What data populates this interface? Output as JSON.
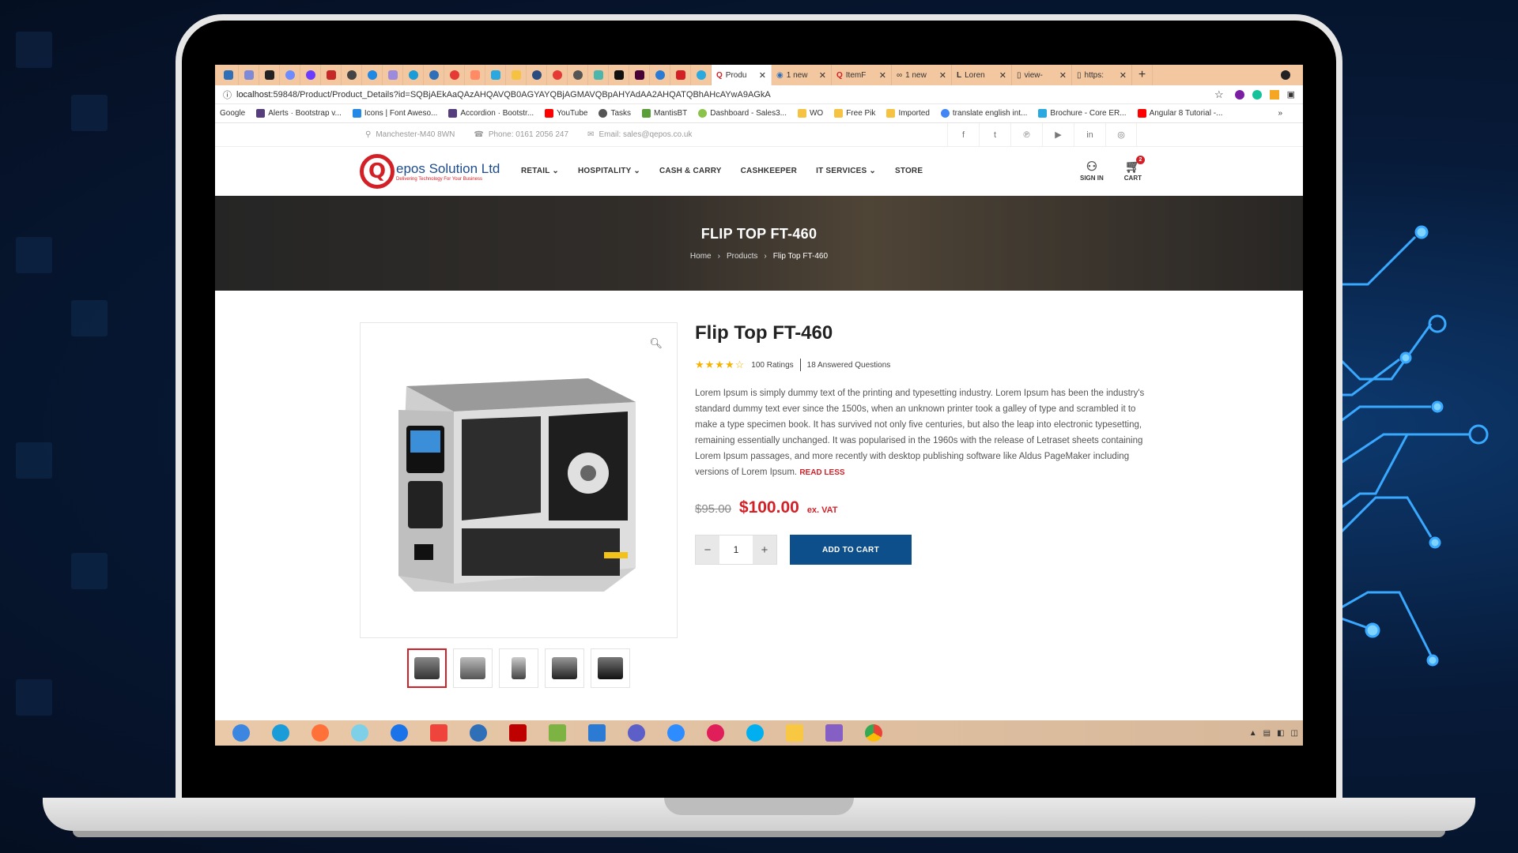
{
  "colors": {
    "brand_red": "#d32027",
    "brand_blue": "#0d4f8b",
    "tabbar": "#f3c7a0"
  },
  "browser": {
    "tabs": [
      {
        "label": "Produ",
        "icon": "qepos-icon",
        "active": true
      },
      {
        "label": "1 new",
        "icon": "hubstaff-icon",
        "active": false
      },
      {
        "label": "ItemF",
        "icon": "qepos-icon",
        "active": false
      },
      {
        "label": "1 new",
        "icon": "infinity-icon",
        "active": false
      },
      {
        "label": "Loren",
        "icon": "lorem-icon",
        "active": false
      },
      {
        "label": "view-",
        "icon": "doc-icon",
        "active": false
      },
      {
        "label": "https:",
        "icon": "doc-icon",
        "active": false
      }
    ],
    "close_glyph": "✕",
    "new_tab_glyph": "+",
    "url_host": "localhost",
    "url_rest": ":59848/Product/Product_Details?id=SQBjAEkAaQAzAHQAVQB0AGYAYQBjAGMAVQBpAHYAdAA2AHQATQBhAHcAYwA9AGkA",
    "bookmarks": [
      {
        "label": "Google",
        "color": "#4285f4"
      },
      {
        "label": "Alerts · Bootstrap v...",
        "color": "#563d7c"
      },
      {
        "label": "Icons | Font Aweso...",
        "color": "#228ae6"
      },
      {
        "label": "Accordion · Bootstr...",
        "color": "#563d7c"
      },
      {
        "label": "YouTube",
        "color": "#ff0000"
      },
      {
        "label": "Tasks",
        "color": "#555555"
      },
      {
        "label": "MantisBT",
        "color": "#5a9e3a"
      },
      {
        "label": "Dashboard - Sales3...",
        "color": "#8bc34a"
      },
      {
        "label": "WO",
        "color": "#f5c242"
      },
      {
        "label": "Free Pik",
        "color": "#f5c242"
      },
      {
        "label": "Imported",
        "color": "#f5c242"
      },
      {
        "label": "translate english int...",
        "color": "#4285f4"
      },
      {
        "label": "Brochure - Core ER...",
        "color": "#29a9e0"
      },
      {
        "label": "Angular 8 Tutorial -...",
        "color": "#ff0000"
      }
    ],
    "bookmarks_more": "»"
  },
  "topbar": {
    "location": "Manchester-M40 8WN",
    "phone": "Phone: 0161 2056 247",
    "email": "Email: sales@qepos.co.uk",
    "social": [
      "facebook-icon",
      "twitter-icon",
      "pinterest-icon",
      "youtube-icon",
      "linkedin-icon",
      "instagram-icon"
    ]
  },
  "header": {
    "logo_letter": "Q",
    "logo_name": "epos Solution Ltd",
    "logo_tagline": "Delivering Technology For Your Business",
    "nav": [
      {
        "label": "RETAIL",
        "dropdown": true
      },
      {
        "label": "HOSPITALITY",
        "dropdown": true
      },
      {
        "label": "CASH & CARRY",
        "dropdown": false
      },
      {
        "label": "CASHKEEPER",
        "dropdown": false
      },
      {
        "label": "IT SERVICES",
        "dropdown": true
      },
      {
        "label": "STORE",
        "dropdown": false
      }
    ],
    "sign_in": "SIGN IN",
    "cart": "CART",
    "cart_count": "2"
  },
  "hero": {
    "title": "FLIP TOP FT-460",
    "breadcrumb": [
      "Home",
      "Products",
      "Flip Top FT-460"
    ]
  },
  "product": {
    "title": "Flip Top FT-460",
    "rating": 4,
    "ratings_text": "100 Ratings",
    "questions_text": "18 Answered Questions",
    "description": "Lorem Ipsum is simply dummy text of the printing and typesetting industry. Lorem Ipsum has been the industry's standard dummy text ever since the 1500s, when an unknown printer took a galley of type and scrambled it to make a type specimen book. It has survived not only five centuries, but also the leap into electronic typesetting, remaining essentially unchanged. It was popularised in the 1960s with the release of Letraset sheets containing Lorem Ipsum passages, and more recently with desktop publishing software like Aldus PageMaker including versions of Lorem Ipsum.",
    "read_less": "READ LESS",
    "old_price": "$95.00",
    "price": "$100.00",
    "vat": "ex. VAT",
    "quantity": "1",
    "add_to_cart": "ADD TO CART",
    "thumbnails": 5
  },
  "taskbar": {
    "apps": [
      {
        "name": "windows-icon",
        "color": "#3a86e0"
      },
      {
        "name": "edge-icon",
        "color": "#1a9cd8"
      },
      {
        "name": "firefox-icon",
        "color": "#ff7139"
      },
      {
        "name": "mail-icon",
        "color": "#7dd0e8"
      },
      {
        "name": "maps-icon",
        "color": "#1a73e8"
      },
      {
        "name": "anydesk-icon",
        "color": "#ef443b"
      },
      {
        "name": "hubstaff-icon",
        "color": "#2f6fb8"
      },
      {
        "name": "filezilla-icon",
        "color": "#bf0000"
      },
      {
        "name": "notepad-icon",
        "color": "#7cb342"
      },
      {
        "name": "writer-icon",
        "color": "#2b7bd4"
      },
      {
        "name": "teams-icon",
        "color": "#5b5fc7"
      },
      {
        "name": "zoom-icon",
        "color": "#2d8cff"
      },
      {
        "name": "slack-icon",
        "color": "#e01e5a"
      },
      {
        "name": "skype-icon",
        "color": "#00aff0"
      },
      {
        "name": "explorer-icon",
        "color": "#f8c842"
      },
      {
        "name": "visual-studio-icon",
        "color": "#865fc5"
      },
      {
        "name": "chrome-icon",
        "color": "#34a853"
      }
    ],
    "tray_arrow": "▲"
  }
}
